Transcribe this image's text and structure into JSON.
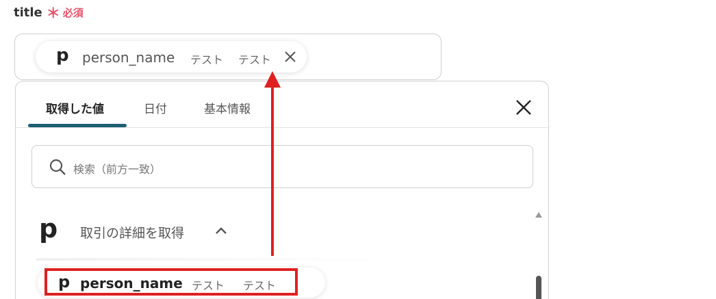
{
  "field": {
    "label": "title",
    "required_mark": "＊",
    "required_text": "必須"
  },
  "chip": {
    "logo": "p",
    "name": "person_name",
    "tag1": "テスト",
    "tag2": "テスト",
    "close_icon": "close-icon"
  },
  "panel": {
    "tabs": [
      {
        "label": "取得した値",
        "active": true
      },
      {
        "label": "日付",
        "active": false
      },
      {
        "label": "基本情報",
        "active": false
      }
    ],
    "close_icon": "close-icon",
    "search": {
      "placeholder": "検索（前方一致）",
      "icon": "search-icon"
    },
    "group": {
      "logo": "p",
      "title": "取引の詳細を取得",
      "chevron": "chevron-up-icon"
    },
    "item": {
      "logo": "p",
      "name": "person_name",
      "tag1": "テスト",
      "tag2": "テスト"
    }
  },
  "colors": {
    "accent": "#1b5f73",
    "required": "#e8526b",
    "annotation": "#e02020"
  }
}
